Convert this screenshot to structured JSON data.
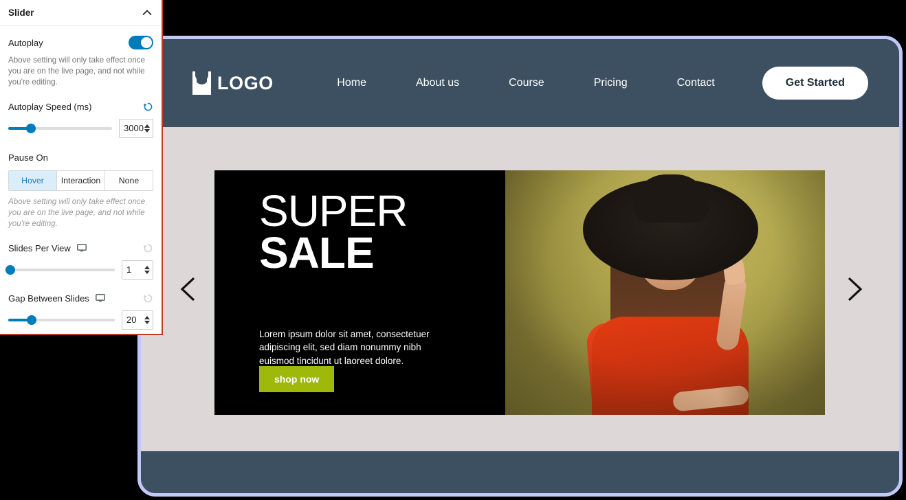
{
  "panel": {
    "title": "Slider",
    "collapse_icon": "chevron-up-icon",
    "autoplay": {
      "label": "Autoplay",
      "enabled": true,
      "help": "Above setting will only take effect once you are on the live page, and not while you're editing."
    },
    "autoplay_speed": {
      "label": "Autoplay Speed (ms)",
      "value": "3000",
      "reset_icon": "reset-icon",
      "slider_percent": 22
    },
    "pause_on": {
      "label": "Pause On",
      "options": [
        "Hover",
        "Interaction",
        "None"
      ],
      "selected": "Hover",
      "help": "Above setting will only take effect once you are on the live page, and not while you're editing."
    },
    "slides_per_view": {
      "label": "Slides Per View",
      "device_icon": "desktop-icon",
      "reset_icon": "reset-icon",
      "value": "1",
      "slider_percent": 0
    },
    "gap_between_slides": {
      "label": "Gap Between Slides",
      "device_icon": "desktop-icon",
      "reset_icon": "reset-icon",
      "value": "20",
      "slider_percent": 20
    }
  },
  "site": {
    "brand": {
      "logo_icon": "logo-mark-icon",
      "name": "LOGO"
    },
    "nav": [
      {
        "label": "Home"
      },
      {
        "label": "About us"
      },
      {
        "label": "Course"
      },
      {
        "label": "Pricing"
      },
      {
        "label": "Contact"
      }
    ],
    "cta": {
      "label": "Get Started"
    },
    "slide": {
      "heading_line1": "SUPER",
      "heading_line2": "SALE",
      "body": "Lorem ipsum dolor sit amet, consectetuer adipiscing elit, sed diam nonummy nibh euismod tincidunt ut laoreet dolore.",
      "button": "shop now",
      "image_alt": "woman in black wide-brim hat and red floral dress"
    },
    "controls": {
      "prev_icon": "chevron-left-icon",
      "next_icon": "chevron-right-icon"
    }
  },
  "colors": {
    "accent_blue": "#007cba",
    "header_bg": "#3c5061",
    "slider_bg": "#ded7d8",
    "cta_green": "#9fb90b",
    "panel_highlight": "#c0392b",
    "frame_border": "#c3c9f7"
  }
}
